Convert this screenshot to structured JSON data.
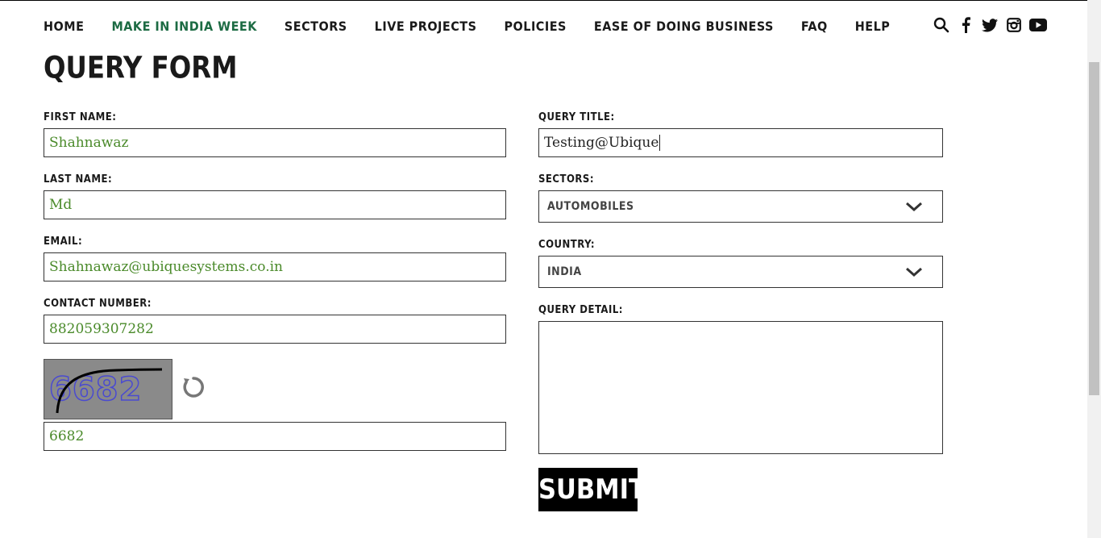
{
  "nav": {
    "items": [
      {
        "label": "HOME",
        "active": false
      },
      {
        "label": "MAKE IN INDIA WEEK",
        "active": true
      },
      {
        "label": "SECTORS",
        "active": false
      },
      {
        "label": "LIVE PROJECTS",
        "active": false
      },
      {
        "label": "POLICIES",
        "active": false
      },
      {
        "label": "EASE OF DOING BUSINESS",
        "active": false
      },
      {
        "label": "FAQ",
        "active": false
      },
      {
        "label": "HELP",
        "active": false
      }
    ],
    "icons": [
      "search-icon",
      "facebook-icon",
      "twitter-icon",
      "instagram-icon",
      "youtube-icon"
    ],
    "active_color": "#1c6b43"
  },
  "page": {
    "title": "QUERY FORM"
  },
  "form": {
    "first_name": {
      "label": "FIRST NAME:",
      "value": "Shahnawaz"
    },
    "last_name": {
      "label": "LAST NAME:",
      "value": "Md"
    },
    "email": {
      "label": "EMAIL:",
      "value": "Shahnawaz@ubiquesystems.co.in"
    },
    "contact": {
      "label": "CONTACT NUMBER:",
      "value": "882059307282"
    },
    "captcha": {
      "image_text": "6682",
      "value": "6682"
    },
    "query_title": {
      "label": "QUERY TITLE:",
      "value": "Testing@Ubique"
    },
    "sectors": {
      "label": "SECTORS:",
      "selected": "AUTOMOBILES"
    },
    "country": {
      "label": "COUNTRY:",
      "selected": "INDIA"
    },
    "query_detail": {
      "label": "QUERY DETAIL:",
      "value": ""
    },
    "submit_label": "SUBMIT"
  }
}
